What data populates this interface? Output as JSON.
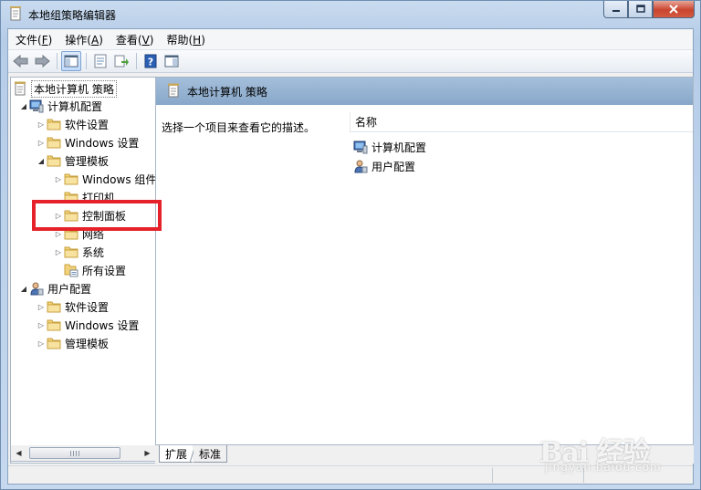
{
  "window": {
    "title": "本地组策略编辑器",
    "controls": [
      "minimize",
      "maximize",
      "close"
    ]
  },
  "menu": [
    {
      "label": "文件(",
      "key": "F",
      "suffix": ")"
    },
    {
      "label": "操作(",
      "key": "A",
      "suffix": ")"
    },
    {
      "label": "查看(",
      "key": "V",
      "suffix": ")"
    },
    {
      "label": "帮助(",
      "key": "H",
      "suffix": ")"
    }
  ],
  "toolbar": {
    "icons": [
      "back-icon",
      "forward-icon",
      "show-hide-tree-icon",
      "properties-icon",
      "export-list-icon",
      "help-icon",
      "show-action-pane-icon"
    ]
  },
  "tree": {
    "root": "本地计算机 策略",
    "items": [
      {
        "label": "计算机配置",
        "level": 1,
        "arrow": "open",
        "icon": "computer"
      },
      {
        "label": "软件设置",
        "level": 2,
        "arrow": "closed",
        "icon": "folder"
      },
      {
        "label": "Windows 设置",
        "level": 2,
        "arrow": "closed",
        "icon": "folder"
      },
      {
        "label": "管理模板",
        "level": 2,
        "arrow": "open",
        "icon": "folder"
      },
      {
        "label": "Windows 组件",
        "level": 3,
        "arrow": "closed",
        "icon": "folder"
      },
      {
        "label": "打印机",
        "level": 3,
        "arrow": "none",
        "icon": "folder"
      },
      {
        "label": "控制面板",
        "level": 3,
        "arrow": "closed",
        "icon": "folder"
      },
      {
        "label": "网络",
        "level": 3,
        "arrow": "closed",
        "icon": "folder"
      },
      {
        "label": "系统",
        "level": 3,
        "arrow": "closed",
        "icon": "folder"
      },
      {
        "label": "所有设置",
        "level": 3,
        "arrow": "none",
        "icon": "settings"
      },
      {
        "label": "用户配置",
        "level": 1,
        "arrow": "open",
        "icon": "user"
      },
      {
        "label": "软件设置",
        "level": 2,
        "arrow": "closed",
        "icon": "folder"
      },
      {
        "label": "Windows 设置",
        "level": 2,
        "arrow": "closed",
        "icon": "folder"
      },
      {
        "label": "管理模板",
        "level": 2,
        "arrow": "closed",
        "icon": "folder"
      }
    ]
  },
  "right_pane": {
    "header_title": "本地计算机 策略",
    "description": "选择一个项目来查看它的描述。",
    "column_header": "名称",
    "items": [
      {
        "label": "计算机配置",
        "icon": "computer"
      },
      {
        "label": "用户配置",
        "icon": "user"
      }
    ]
  },
  "tabs": [
    {
      "label": "扩展",
      "active": true
    },
    {
      "label": "标准",
      "active": false
    }
  ],
  "watermark": {
    "main": "Bai 经验",
    "sub": "jingyan.baidu.com"
  },
  "colors": {
    "highlight_border": "#e5212a",
    "pane_header": "#93b0d0",
    "folder": "#e8c25a"
  }
}
